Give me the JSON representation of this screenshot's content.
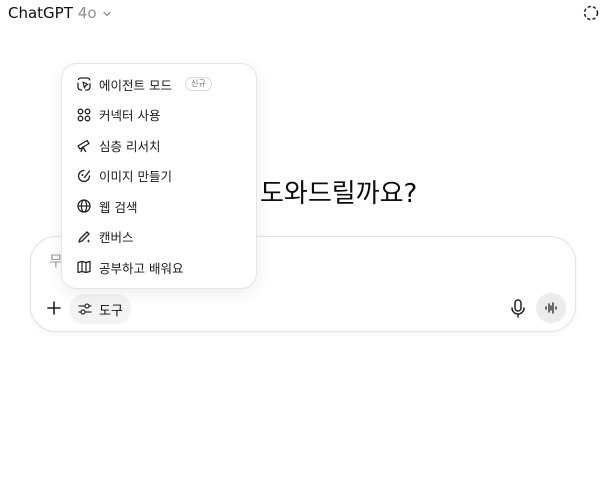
{
  "header": {
    "app_name": "ChatGPT",
    "model": "4o"
  },
  "main": {
    "headline": "도와드릴까요?"
  },
  "composer": {
    "placeholder_visible": "무",
    "tools_label": "도구"
  },
  "tools_menu": {
    "items": [
      {
        "label": "에이전트 모드",
        "icon": "agent-icon",
        "badge": "신규"
      },
      {
        "label": "커넥터 사용",
        "icon": "connectors-icon"
      },
      {
        "label": "심층 리서치",
        "icon": "telescope-icon"
      },
      {
        "label": "이미지 만들기",
        "icon": "image-create-icon"
      },
      {
        "label": "웹 검색",
        "icon": "globe-icon"
      },
      {
        "label": "캔버스",
        "icon": "pen-icon"
      },
      {
        "label": "공부하고 배워요",
        "icon": "book-icon"
      }
    ]
  },
  "colors": {
    "text": "#0d0d0d",
    "muted": "#8f8f8f",
    "border": "#e3e3e3",
    "pill_bg": "#f3f3f3"
  }
}
